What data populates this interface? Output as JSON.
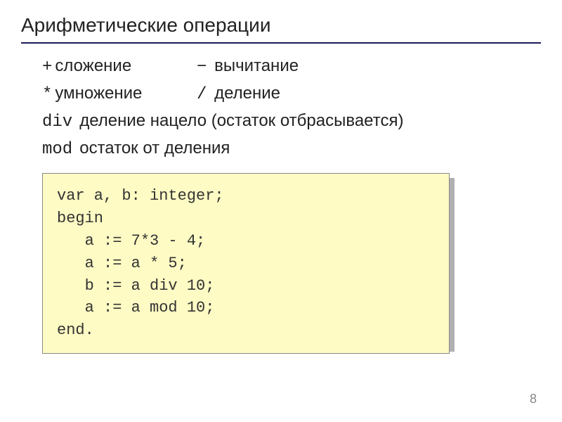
{
  "title": "Арифметические операции",
  "ops": {
    "row1": {
      "left_symbol": "+",
      "left_label": "сложение",
      "right_symbol": "−",
      "right_label": "вычитание"
    },
    "row2": {
      "left_symbol": "*",
      "left_label": "умножение",
      "right_symbol": "/",
      "right_label": "деление"
    },
    "row3": {
      "keyword": "div",
      "desc": "деление нацело (остаток отбрасывается)"
    },
    "row4": {
      "keyword": "mod",
      "desc": "остаток от деления"
    }
  },
  "code": {
    "line1": "var a, b: integer;",
    "line2": "begin",
    "line3": "   a := 7*3 - 4;",
    "line4": "   a := a * 5;",
    "line5": "   b := a div 10;",
    "line6": "   a := a mod 10;",
    "line7": "end."
  },
  "page_number": "8"
}
